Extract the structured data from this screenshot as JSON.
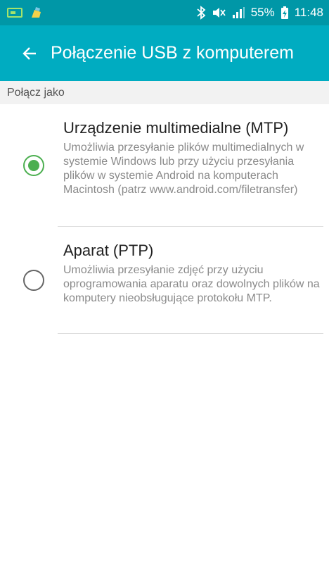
{
  "status_bar": {
    "battery_percent": "55%",
    "time": "11:48",
    "icons": [
      "screen-cast-icon",
      "cleaning-brush-icon",
      "bluetooth-icon",
      "mute-icon",
      "signal-icon",
      "charging-battery-icon"
    ]
  },
  "app_bar": {
    "title": "Połączenie USB z komputerem",
    "back_icon": "back-arrow-icon"
  },
  "section": {
    "header": "Połącz jako"
  },
  "options": [
    {
      "title": "Urządzenie multimedialne (MTP)",
      "description": "Umożliwia przesyłanie plików multimedialnych w systemie Windows lub przy użyciu przesyłania plików w systemie Android na komputerach Macintosh (patrz www.android.com/filetransfer)",
      "selected": true
    },
    {
      "title": "Aparat (PTP)",
      "description": "Umożliwia przesyłanie zdjęć przy użyciu oprogramowania aparatu oraz dowolnych plików na komputery nieobsługujące protokołu MTP.",
      "selected": false
    }
  ],
  "colors": {
    "status_bar": "#0097a7",
    "app_bar": "#00acc1",
    "radio_selected": "#4caf50",
    "section_header_bg": "#f2f2f2"
  }
}
